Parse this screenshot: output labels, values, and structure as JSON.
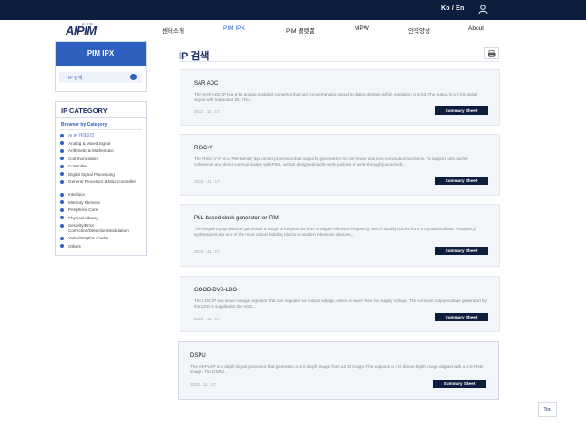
{
  "header": {
    "lang": "Ko / En",
    "logo_sub": "AI·PIM",
    "logo_main_ai": "AI",
    "logo_main_pim": "PIM",
    "nav": [
      "센터소개",
      "PIM IPX",
      "PIM 플랫폼",
      "MPW",
      "인력양성",
      "About"
    ],
    "nav_active": "PIM IPX"
  },
  "sidebar": {
    "pim_title": "PIM IPX",
    "pim_item": "IP 검색",
    "category_title": "IP CATEGORY",
    "browse_label": "Browser by Category",
    "categories": [
      "AI IP 카테고리",
      "Analog & Mixed Signal",
      "Arithmetic & Mathematic",
      "Communication",
      "Controller",
      "Digital Signal Processing",
      "General Processor & Microcontroller",
      "Interface",
      "Memory Element",
      "Peripheral Core",
      "Physical Library",
      "Security/Error Correction/Detection/Modulation",
      "Video/Graphic /Audio",
      "Others"
    ]
  },
  "main": {
    "title": "IP 검색",
    "summary_label": "Summary Sheet",
    "top_label": "Top",
    "cards": [
      {
        "title": "SAR ADC",
        "desc": "The SAR ADC IP is a 6-bit analog to digital convertor that can convert analog signal to digital domain within resolution of 6-bit. The output is a 7-bit digital signal with redundant bit. The...",
        "date": "2022 . 11 . 17"
      },
      {
        "title": "RISC-V",
        "desc": "The RISC-V IP is a PIM-friendly 5ip control processor that supports general ISA for non-linear and non-convolution functions. To support both cache coherence and direct communication with PIM, custom designed cache write policies of write-through(uncached)...",
        "date": "2022 . 11 . 17"
      },
      {
        "title": "PLL-based clock generator for PIM",
        "desc": "The frequency synthesizer generates a range of frequencies from a single reference frequency, which usually comes from a crystal oscillator. Frequency synthesizers are one of the most critical building blocks in modern electronic devices,...",
        "date": "2022 . 11 . 17"
      },
      {
        "title": "GOOD-DVS-LDO",
        "desc": "The LDO IP is a linear voltage regulator that can regulate the output voltage, which is lower than the supply voltage. The constant output voltage generated by the LDO is supplied to the VDD...",
        "date": "2022 . 11 . 17"
      },
      {
        "title": "DSPU",
        "desc": "The DSPU IP is a depth signal processor that generates a 3-D depth image from a 2-D image. The output is a 3-D dense depth image aligned with a 2-D RGB image. The DSPU...",
        "date": "2022 . 11 . 17"
      }
    ]
  }
}
